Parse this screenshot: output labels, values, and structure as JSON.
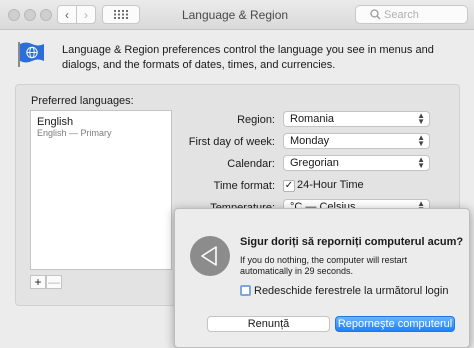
{
  "window": {
    "title": "Language & Region",
    "search_placeholder": "Search"
  },
  "header": {
    "description": "Language & Region preferences control the language you see in menus and dialogs, and the formats of dates, times, and currencies."
  },
  "languages": {
    "title": "Preferred languages:",
    "items": [
      {
        "name": "English",
        "subtitle": "English — Primary"
      }
    ],
    "add_label": "+",
    "remove_label": "—"
  },
  "settings": {
    "region_label": "Region:",
    "region_value": "Romania",
    "first_day_label": "First day of week:",
    "first_day_value": "Monday",
    "calendar_label": "Calendar:",
    "calendar_value": "Gregorian",
    "time_format_label": "Time format:",
    "time_format_option": "24-Hour Time",
    "time_format_checked": true,
    "temperature_label": "Temperature:",
    "temperature_value": "°C — Celsius"
  },
  "alert": {
    "title": "Sigur doriți să reporniți computerul acum?",
    "message": "If you do nothing, the computer will restart automatically in 29 seconds.",
    "checkbox_label": "Redeschide ferestrele la următorul login",
    "cancel_label": "Renunță",
    "confirm_label": "Reporneşte computerul"
  },
  "colors": {
    "accent": "#1a82fb",
    "flag_blue": "#2b6fd6"
  }
}
